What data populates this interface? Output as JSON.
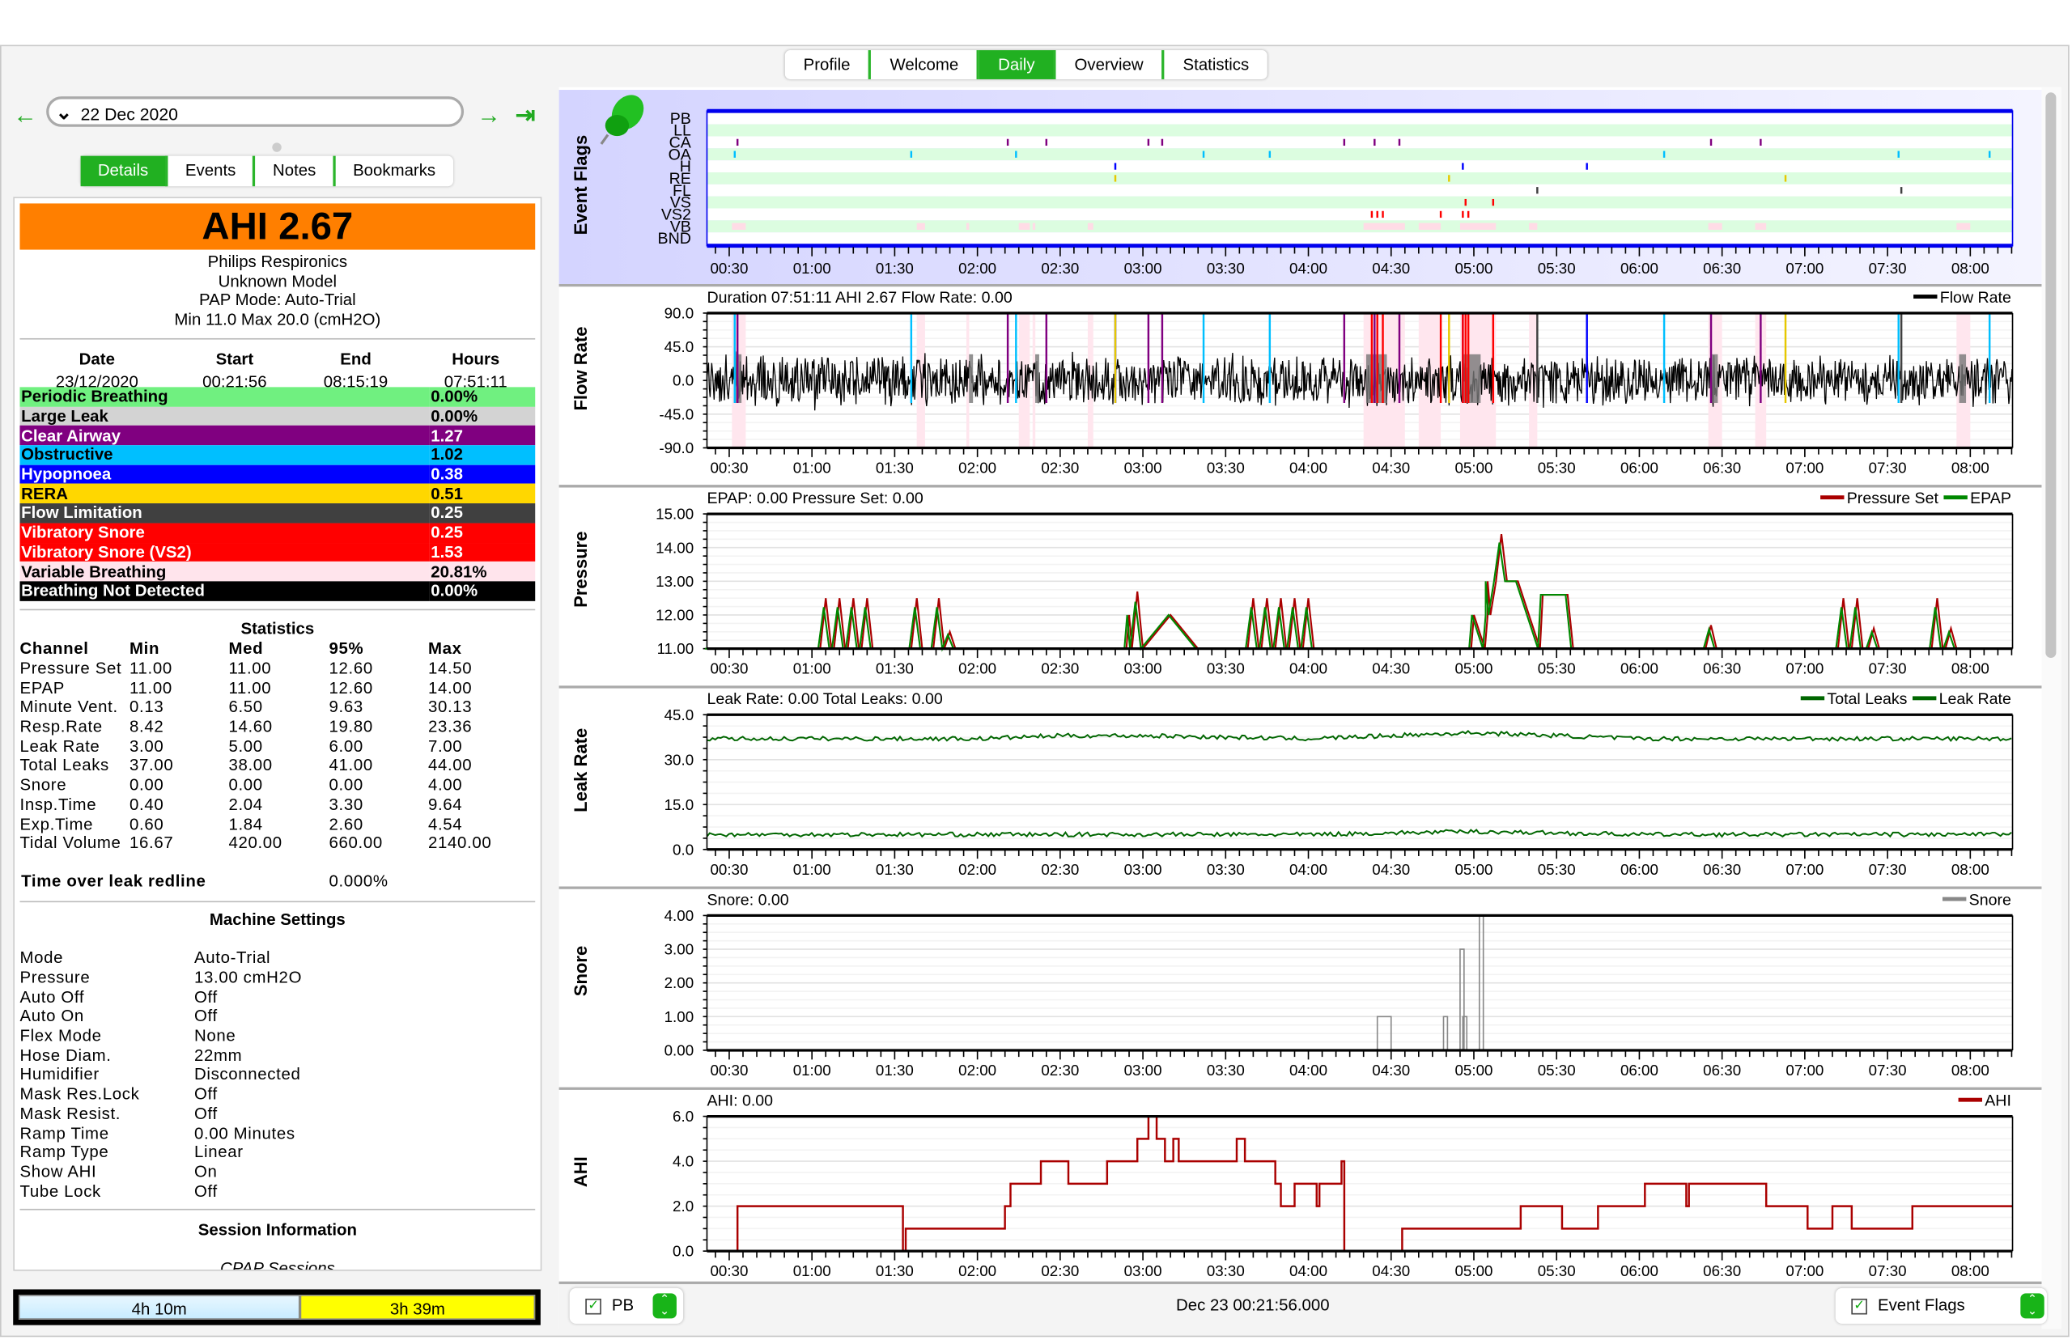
{
  "top_tabs": [
    {
      "label": "Profile"
    },
    {
      "label": "Welcome"
    },
    {
      "label": "Daily",
      "active": true
    },
    {
      "label": "Overview"
    },
    {
      "label": "Statistics"
    }
  ],
  "nav": {
    "date": "22 Dec 2020",
    "prev_icon": "arrow-left-icon",
    "next_icon": "arrow-right-icon",
    "last_icon": "jump-to-end-icon"
  },
  "left_tabs": [
    {
      "label": "Details",
      "active": true
    },
    {
      "label": "Events"
    },
    {
      "label": "Notes"
    },
    {
      "label": "Bookmarks"
    }
  ],
  "summary": {
    "ahi": "AHI 2.67",
    "ahi_color": "#ff7f00",
    "lines": [
      "Philips Respironics",
      "Unknown Model",
      "PAP Mode: Auto-Trial",
      "Min 11.0 Max 20.0 (cmH2O)"
    ],
    "headers": [
      "Date",
      "Start",
      "End",
      "Hours"
    ],
    "values": [
      "23/12/2020",
      "00:21:56",
      "08:15:19",
      "07:51:11"
    ]
  },
  "event_indices": [
    {
      "label": "Periodic Breathing",
      "value": "0.00%",
      "bg": "#70f080",
      "fg": "#000000"
    },
    {
      "label": "Large Leak",
      "value": "0.00%",
      "bg": "#d3d3d3",
      "fg": "#000000"
    },
    {
      "label": "Clear Airway",
      "value": "1.27",
      "bg": "#800080",
      "fg": "#ffffff"
    },
    {
      "label": "Obstructive",
      "value": "1.02",
      "bg": "#00bfff",
      "fg": "#000000"
    },
    {
      "label": "Hypopnoea",
      "value": "0.38",
      "bg": "#0000ff",
      "fg": "#ffffff"
    },
    {
      "label": "RERA",
      "value": "0.51",
      "bg": "#ffd700",
      "fg": "#000000"
    },
    {
      "label": "Flow Limitation",
      "value": "0.25",
      "bg": "#404040",
      "fg": "#ffffff"
    },
    {
      "label": "Vibratory Snore",
      "value": "0.25",
      "bg": "#ff0000",
      "fg": "#ffffff"
    },
    {
      "label": "Vibratory Snore (VS2)",
      "value": "1.53",
      "bg": "#ff0000",
      "fg": "#ffffff"
    },
    {
      "label": "Variable Breathing",
      "value": "20.81%",
      "bg": "#ffe4ec",
      "fg": "#000000"
    },
    {
      "label": "Breathing Not Detected",
      "value": "0.00%",
      "bg": "#000000",
      "fg": "#ffffff"
    }
  ],
  "statistics": {
    "title": "Statistics",
    "headers": [
      "Channel",
      "Min",
      "Med",
      "95%",
      "Max"
    ],
    "rows": [
      [
        "Pressure Set",
        "11.00",
        "11.00",
        "12.60",
        "14.50"
      ],
      [
        "EPAP",
        "11.00",
        "11.00",
        "12.60",
        "14.00"
      ],
      [
        "Minute Vent.",
        "0.13",
        "6.50",
        "9.63",
        "30.13"
      ],
      [
        "Resp.Rate",
        "8.42",
        "14.60",
        "19.80",
        "23.36"
      ],
      [
        "Leak Rate",
        "3.00",
        "5.00",
        "6.00",
        "7.00"
      ],
      [
        "Total Leaks",
        "37.00",
        "38.00",
        "41.00",
        "44.00"
      ],
      [
        "Snore",
        "0.00",
        "0.00",
        "0.00",
        "4.00"
      ],
      [
        "Insp.Time",
        "0.40",
        "2.04",
        "3.30",
        "9.64"
      ],
      [
        "Exp.Time",
        "0.60",
        "1.84",
        "2.60",
        "4.54"
      ],
      [
        "Tidal Volume",
        "16.67",
        "420.00",
        "660.00",
        "2140.00"
      ]
    ],
    "leak_redline_label": "Time over leak redline",
    "leak_redline_value": "0.000%"
  },
  "machine_settings": {
    "title": "Machine Settings",
    "rows": [
      [
        "Mode",
        "Auto-Trial"
      ],
      [
        "Pressure",
        "13.00 cmH2O"
      ],
      [
        "Auto Off",
        "Off"
      ],
      [
        "Auto On",
        "Off"
      ],
      [
        "Flex Mode",
        "None"
      ],
      [
        "Hose Diam.",
        "22mm"
      ],
      [
        "Humidifier",
        "Disconnected"
      ],
      [
        "Mask Res.Lock",
        "Off"
      ],
      [
        "Mask Resist.",
        "Off"
      ],
      [
        "Ramp Time",
        "0.00 Minutes"
      ],
      [
        "Ramp Type",
        "Linear"
      ],
      [
        "Show AHI",
        "On"
      ],
      [
        "Tube Lock",
        "Off"
      ]
    ]
  },
  "session_info": {
    "title": "Session Information",
    "subtitle": "CPAP Sessions"
  },
  "session_bar": [
    {
      "label": "4h 10m",
      "color": "#c8ecff"
    },
    {
      "label": "3h 39m",
      "color": "#ffff00"
    }
  ],
  "time_axis": {
    "start": "00:21:56",
    "end": "08:15:19",
    "ticks": [
      "00:30",
      "01:00",
      "01:30",
      "02:00",
      "02:30",
      "03:00",
      "03:30",
      "04:00",
      "04:30",
      "05:00",
      "05:30",
      "06:00",
      "06:30",
      "07:00",
      "07:30",
      "08:00"
    ]
  },
  "event_flags": {
    "title": "Event Flags",
    "icon": "pushpin-icon",
    "rows": [
      "PB",
      "LL",
      "CA",
      "OA",
      "H",
      "RE",
      "FL",
      "VS",
      "VS2",
      "VB",
      "BND"
    ],
    "colors": {
      "CA": "#800080",
      "OA": "#00bfff",
      "H": "#0000ff",
      "RE": "#e6c800",
      "FL": "#404040",
      "VS": "#ff0000",
      "VS2": "#ff0000",
      "VB": "#ffdce6"
    },
    "events": {
      "CA": [
        "00:33",
        "02:11",
        "02:25",
        "03:02",
        "03:07",
        "04:13",
        "04:24",
        "04:33",
        "06:26",
        "06:44"
      ],
      "OA": [
        "00:32",
        "01:36",
        "02:14",
        "03:22",
        "03:46",
        "06:09",
        "07:34",
        "08:07"
      ],
      "H": [
        "02:50",
        "04:56",
        "05:41"
      ],
      "RE": [
        "02:50",
        "04:51",
        "06:53"
      ],
      "FL": [
        "05:23",
        "07:35"
      ],
      "VS": [
        "04:57",
        "05:07"
      ],
      "VS2": [
        "04:23",
        "04:25",
        "04:27",
        "04:48",
        "04:56",
        "04:58"
      ],
      "VB": [
        [
          "00:31",
          "00:36"
        ],
        [
          "01:38",
          "01:41"
        ],
        [
          "01:56",
          "01:57"
        ],
        [
          "02:15",
          "02:19"
        ],
        [
          "02:20",
          "02:21"
        ],
        [
          "02:40",
          "02:42"
        ],
        [
          "04:20",
          "04:35"
        ],
        [
          "04:40",
          "04:48"
        ],
        [
          "04:55",
          "05:08"
        ],
        [
          "05:20",
          "05:23"
        ],
        [
          "06:25",
          "06:30"
        ],
        [
          "06:42",
          "06:46"
        ],
        [
          "07:55",
          "08:00"
        ]
      ]
    }
  },
  "charts": [
    {
      "id": "flow",
      "ylabel": "Flow Rate",
      "header": "Duration 07:51:11 AHI 2.67 Flow Rate: 0.00",
      "legend": [
        {
          "name": "Flow Rate",
          "color": "#000000"
        }
      ],
      "yticks": [
        "90.0",
        "45.0",
        "0.0",
        "-45.0",
        "-90.0"
      ],
      "ylim": [
        -90,
        90
      ],
      "type": "waveform"
    },
    {
      "id": "pressure",
      "ylabel": "Pressure",
      "header": "EPAP: 0.00 Pressure Set: 0.00",
      "legend": [
        {
          "name": "Pressure Set",
          "color": "#aa0000"
        },
        {
          "name": "EPAP",
          "color": "#008800"
        }
      ],
      "yticks": [
        "15.00",
        "14.00",
        "13.00",
        "12.00",
        "11.00"
      ],
      "ylim": [
        11,
        15
      ],
      "type": "line",
      "baseline": 11,
      "points": [
        [
          "01:05",
          12.5
        ],
        [
          "01:10",
          12.5
        ],
        [
          "01:15",
          12.5
        ],
        [
          "01:20",
          12.5
        ],
        [
          "01:38",
          12.5
        ],
        [
          "01:46",
          12.5
        ],
        [
          "01:50",
          11.5
        ],
        [
          "02:58",
          12.7
        ],
        [
          "03:40",
          12.5
        ],
        [
          "03:45",
          12.5
        ],
        [
          "03:50",
          12.5
        ],
        [
          "03:55",
          12.5
        ],
        [
          "04:00",
          12.5
        ],
        [
          "06:26",
          11.7
        ],
        [
          "07:14",
          12.5
        ],
        [
          "07:19",
          12.5
        ],
        [
          "07:25",
          11.6
        ],
        [
          "07:48",
          12.5
        ],
        [
          "07:53",
          11.6
        ]
      ],
      "plateaus": [
        [
          "02:55",
          "03:10",
          12.0,
          "03:20"
        ],
        [
          "05:00",
          "05:05",
          12.0,
          null
        ],
        [
          "05:05",
          "05:15",
          13.0,
          null
        ],
        [
          "05:25",
          "05:34",
          12.6,
          "05:36"
        ]
      ],
      "peak": [
        "05:10",
        14.4
      ]
    },
    {
      "id": "leak",
      "ylabel": "Leak Rate",
      "header": "Leak Rate: 0.00 Total Leaks: 0.00",
      "legend": [
        {
          "name": "Total Leaks",
          "color": "#006600"
        },
        {
          "name": "Leak Rate",
          "color": "#006600"
        }
      ],
      "yticks": [
        "45.0",
        "30.0",
        "15.0",
        "0.0"
      ],
      "ylim": [
        0,
        45
      ],
      "type": "noisy",
      "series": [
        {
          "name": "Total Leaks",
          "times": [
            "00:22",
            "01:00",
            "02:00",
            "02:30",
            "03:00",
            "04:00",
            "04:30",
            "05:00",
            "05:30",
            "06:00",
            "07:00",
            "08:15"
          ],
          "values": [
            37,
            37,
            37,
            38,
            38,
            37,
            38,
            39,
            38,
            37,
            37,
            37
          ]
        },
        {
          "name": "Leak Rate",
          "times": [
            "00:22",
            "01:00",
            "02:00",
            "03:00",
            "04:00",
            "05:00",
            "06:00",
            "07:00",
            "08:15"
          ],
          "values": [
            5,
            5,
            5,
            5,
            5,
            6,
            5,
            5,
            5
          ]
        }
      ]
    },
    {
      "id": "snore",
      "ylabel": "Snore",
      "header": "Snore: 0.00",
      "legend": [
        {
          "name": "Snore",
          "color": "#888888"
        }
      ],
      "yticks": [
        "4.00",
        "3.00",
        "2.00",
        "1.00",
        "0.00"
      ],
      "ylim": [
        0,
        4
      ],
      "type": "bars",
      "bars": [
        [
          "04:25",
          "04:30",
          1
        ],
        [
          "04:49",
          "04:50",
          1
        ],
        [
          "04:55",
          "04:56",
          3
        ],
        [
          "04:56",
          "04:57",
          1
        ],
        [
          "05:02",
          "05:03",
          4
        ]
      ]
    },
    {
      "id": "ahi",
      "ylabel": "AHI",
      "header": "AHI: 0.00",
      "legend": [
        {
          "name": "AHI",
          "color": "#aa0000"
        }
      ],
      "yticks": [
        "6.0",
        "4.0",
        "2.0",
        "0.0"
      ],
      "ylim": [
        0,
        6
      ],
      "type": "step",
      "steps": [
        [
          "00:22",
          0
        ],
        [
          "00:33",
          2
        ],
        [
          "01:33",
          0
        ],
        [
          "01:34",
          1
        ],
        [
          "02:10",
          2
        ],
        [
          "02:12",
          3
        ],
        [
          "02:23",
          4
        ],
        [
          "02:33",
          3
        ],
        [
          "02:47",
          4
        ],
        [
          "02:58",
          5
        ],
        [
          "03:02",
          6
        ],
        [
          "03:05",
          5
        ],
        [
          "03:08",
          4
        ],
        [
          "03:11",
          5
        ],
        [
          "03:13",
          4
        ],
        [
          "03:34",
          5
        ],
        [
          "03:37",
          4
        ],
        [
          "03:48",
          3
        ],
        [
          "03:50",
          2
        ],
        [
          "03:55",
          3
        ],
        [
          "04:03",
          2
        ],
        [
          "04:04",
          3
        ],
        [
          "04:12",
          4
        ],
        [
          "04:13",
          0
        ],
        [
          "04:34",
          1
        ],
        [
          "05:17",
          2
        ],
        [
          "05:32",
          1
        ],
        [
          "05:45",
          2
        ],
        [
          "06:02",
          3
        ],
        [
          "06:17",
          2
        ],
        [
          "06:18",
          3
        ],
        [
          "06:46",
          2
        ],
        [
          "07:01",
          1
        ],
        [
          "07:10",
          2
        ],
        [
          "07:17",
          1
        ],
        [
          "07:39",
          2
        ]
      ]
    }
  ],
  "bottom": {
    "left_label": "PB",
    "left_checked": true,
    "status": "Dec 23 00:21:56.000",
    "right_label": "Event Flags",
    "right_checked": true
  }
}
